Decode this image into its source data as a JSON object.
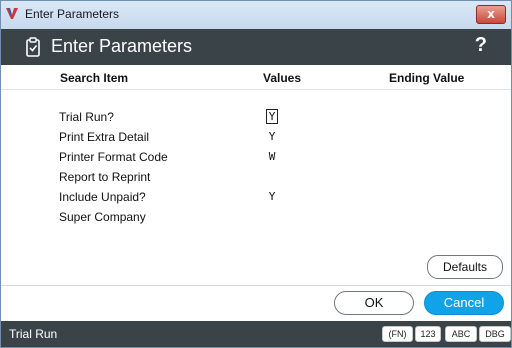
{
  "window": {
    "title": "Enter Parameters",
    "close_glyph": "x"
  },
  "header": {
    "title": "Enter Parameters",
    "help_glyph": "?"
  },
  "columns": {
    "search_item": "Search Item",
    "values": "Values",
    "ending_value": "Ending Value"
  },
  "params": [
    {
      "label": "Trial Run?",
      "value": "Y"
    },
    {
      "label": "Print Extra Detail",
      "value": "Y"
    },
    {
      "label": "Printer Format Code",
      "value": "W"
    },
    {
      "label": "Report to Reprint",
      "value": ""
    },
    {
      "label": "Include Unpaid?",
      "value": "Y"
    },
    {
      "label": "Super Company",
      "value": ""
    }
  ],
  "buttons": {
    "defaults": "Defaults",
    "ok": "OK",
    "cancel": "Cancel"
  },
  "status": {
    "text": "Trial Run",
    "badges": [
      "(FN)",
      "123",
      "ABC",
      "DBG"
    ]
  },
  "colors": {
    "header_bg": "#3a4348",
    "accent": "#11a3ea"
  }
}
